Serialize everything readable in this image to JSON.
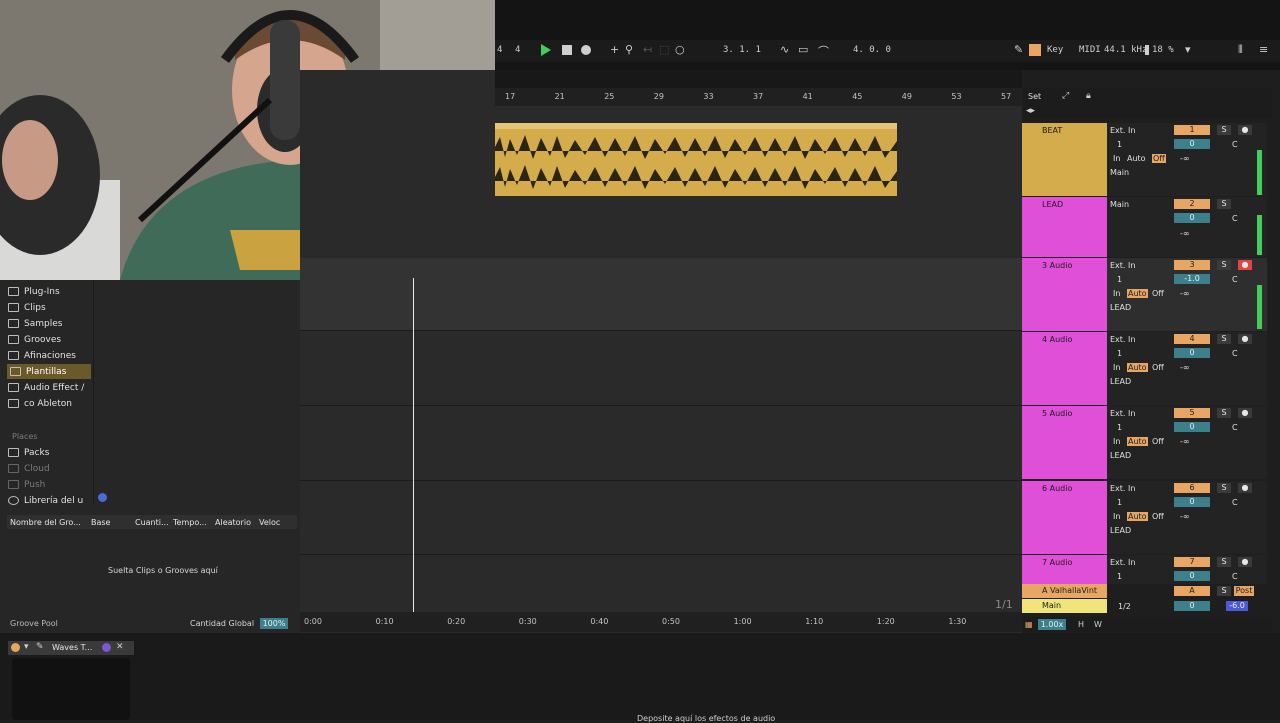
{
  "transport": {
    "signature_num": "4",
    "signature_den": "4",
    "position": "3.   1.   1",
    "loop_length": "4.   0.   0",
    "key_label": "Key",
    "midi_label": "MIDI",
    "sample_rate": "44.1 kHz",
    "cpu": "18 %"
  },
  "browser": {
    "items": [
      "Plug-Ins",
      "Clips",
      "Samples",
      "Grooves",
      "Afinaciones",
      "Plantillas",
      "Audio Effect /",
      "co Ableton"
    ],
    "places_label": "Places",
    "places": [
      "Packs",
      "Cloud",
      "Push",
      "Librería del u"
    ],
    "columns": [
      "Nombre del Gro...",
      "Base",
      "Cuanti...",
      "Tempo...",
      "Aleatorio",
      "Veloc"
    ],
    "drop_hint": "Suelta Clips o Grooves aquí",
    "groove_pool_label": "Groove Pool",
    "global_amount_label": "Cantidad Global",
    "global_amount": "100%"
  },
  "ruler": [
    "17",
    "21",
    "25",
    "29",
    "33",
    "37",
    "41",
    "45",
    "49",
    "53",
    "57"
  ],
  "timeline": [
    "0:00",
    "0:10",
    "0:20",
    "0:30",
    "0:40",
    "0:50",
    "1:00",
    "1:10",
    "1:20",
    "1:30"
  ],
  "page_indicator": "1/1",
  "set_label": "Set",
  "tracks": [
    {
      "name": "BEAT",
      "input": "Ext. In",
      "channel": "1",
      "monitor": [
        "In",
        "Auto",
        "Off"
      ],
      "output": "Main",
      "number": "1",
      "volume": "0",
      "pan": "C",
      "send": "-∞"
    },
    {
      "name": "LEAD",
      "input": "Main",
      "number": "2",
      "volume": "0",
      "pan": "C",
      "send": "-∞"
    },
    {
      "name": "3 Audio",
      "input": "Ext. In",
      "channel": "1",
      "monitor": [
        "In",
        "Auto",
        "Off"
      ],
      "output": "LEAD",
      "number": "3",
      "volume": "-1.0",
      "pan": "C",
      "send": "-∞"
    },
    {
      "name": "4 Audio",
      "input": "Ext. In",
      "channel": "1",
      "monitor": [
        "In",
        "Auto",
        "Off"
      ],
      "output": "LEAD",
      "number": "4",
      "volume": "0",
      "pan": "C",
      "send": "-∞"
    },
    {
      "name": "5 Audio",
      "input": "Ext. In",
      "channel": "1",
      "monitor": [
        "In",
        "Auto",
        "Off"
      ],
      "output": "LEAD",
      "number": "5",
      "volume": "0",
      "pan": "C",
      "send": "-∞"
    },
    {
      "name": "6 Audio",
      "input": "Ext. In",
      "channel": "1",
      "monitor": [
        "In",
        "Auto",
        "Off"
      ],
      "output": "LEAD",
      "number": "6",
      "volume": "0",
      "pan": "C",
      "send": "-∞"
    },
    {
      "name": "7 Audio",
      "input": "Ext. In",
      "channel": "1",
      "number": "7",
      "volume": "0",
      "pan": "C"
    }
  ],
  "return_track": {
    "name": "A ValhallaVint",
    "letter": "A",
    "post": "Post"
  },
  "main_track": {
    "name": "Main",
    "ratio": "1/2",
    "volume": "0",
    "pan": "-6.0"
  },
  "zoom": "1.00x",
  "hw": [
    "H",
    "W"
  ],
  "device": {
    "name": "Waves T...",
    "drop_hint": "Deposite aquí los efectos de audio"
  },
  "solo_label": "S",
  "colors": {
    "beat": "#d4ac4c",
    "lead": "#e04fd8",
    "accent": "#e8a665"
  }
}
